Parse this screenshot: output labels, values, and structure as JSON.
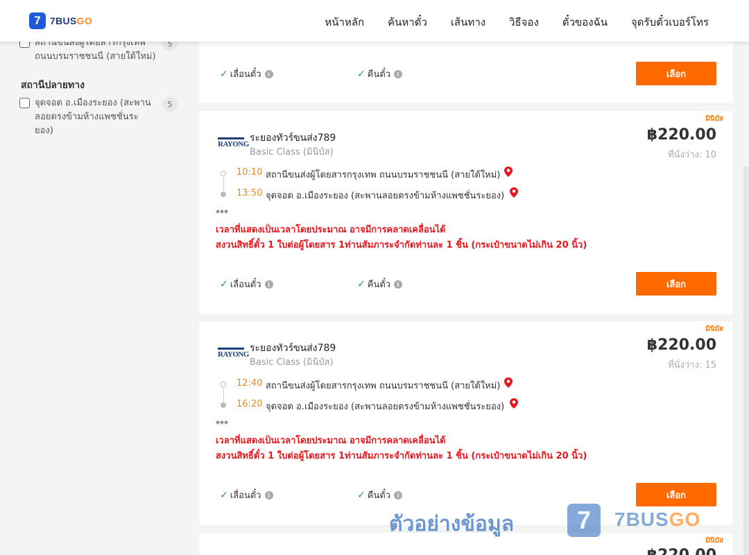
{
  "header": {
    "logo_mark": "7",
    "logo_text_main": "7BUS",
    "logo_text_accent": "GO",
    "nav": [
      "หน้าหลัก",
      "ค้นหาตั๋ว",
      "เส้นทาง",
      "วิธีจอง",
      "ตั๋วของฉัน",
      "จุดรับตั๋วเบอร์โทร"
    ]
  },
  "sidebar": {
    "origin_item": {
      "label": "สถานีขนส่งผู้โดยสารกรุงเทพ ถนนบรมราชชนนี (สายใต้ใหม่)",
      "count": "5"
    },
    "destination_title": "สถานีปลายทาง",
    "destination_item": {
      "label": "จุดจอด อ.เมืองระยอง (สะพานลอยตรงข้ามห้างแพชชั่นระยอง)",
      "count": "5"
    }
  },
  "top_card": {
    "reschedule": "เลื่อนตั๋ว",
    "refund": "คืนตั๋ว",
    "select": "เลือก"
  },
  "trips": [
    {
      "badge": "มินิบัส",
      "logo": "RAYONG",
      "operator": "ระยองทัวร์ขนส่ง789",
      "bus_class": "Basic Class (มินิบัส)",
      "price": "฿220.00",
      "seats": "ที่นั่งว่าง: 10",
      "depart_time": "10:10",
      "depart_stop": "สถานีขนส่งผู้โดยสารกรุงเทพ ถนนบรมราชชนนี (สายใต้ใหม่)",
      "arrive_time": "13:50",
      "arrive_stop": "จุดจอด อ.เมืองระยอง (สะพานลอยตรงข้ามห้างแพชชั่นระยอง)",
      "stars": "***",
      "notice_1": "เวลาที่แสดงเป็นเวลาโดยประมาณ อาจมีการคลาดเคลื่อนได้",
      "notice_2": "สงวนสิทธิ์ตั๋ว 1 ใบต่อผู้โดยสาร 1ท่านสัมภาระจำกัดท่านละ 1 ชิ้น (กระเป๋าขนาดไม่เกิน 20 นิ้ว)",
      "reschedule": "เลื่อนตั๋ว",
      "refund": "คืนตั๋ว",
      "select": "เลือก"
    },
    {
      "badge": "มินิบัส",
      "logo": "RAYONG",
      "operator": "ระยองทัวร์ขนส่ง789",
      "bus_class": "Basic Class (มินิบัส)",
      "price": "฿220.00",
      "seats": "ที่นั่งว่าง: 15",
      "depart_time": "12:40",
      "depart_stop": "สถานีขนส่งผู้โดยสารกรุงเทพ ถนนบรมราชชนนี (สายใต้ใหม่)",
      "arrive_time": "16:20",
      "arrive_stop": "จุดจอด อ.เมืองระยอง (สะพานลอยตรงข้ามห้างแพชชั่นระยอง)",
      "stars": "***",
      "notice_1": "เวลาที่แสดงเป็นเวลาโดยประมาณ อาจมีการคลาดเคลื่อนได้",
      "notice_2": "สงวนสิทธิ์ตั๋ว 1 ใบต่อผู้โดยสาร 1ท่านสัมภาระจำกัดท่านละ 1 ชิ้น (กระเป๋าขนาดไม่เกิน 20 นิ้ว)",
      "reschedule": "เลื่อนตั๋ว",
      "refund": "คืนตั๋ว",
      "select": "เลือก"
    }
  ],
  "bottom_card": {
    "badge": "มินิบัส",
    "price": "฿220.00"
  },
  "watermark": {
    "text": "ตัวอย่างข้อมูล",
    "logo_mark": "7",
    "brand_main": "7BUS",
    "brand_accent": "GO"
  },
  "colors": {
    "accent": "#ff6a00",
    "time": "#e8891d",
    "notice": "#e8141b",
    "check": "#29a23a",
    "brand_blue": "#1f5bd8"
  }
}
